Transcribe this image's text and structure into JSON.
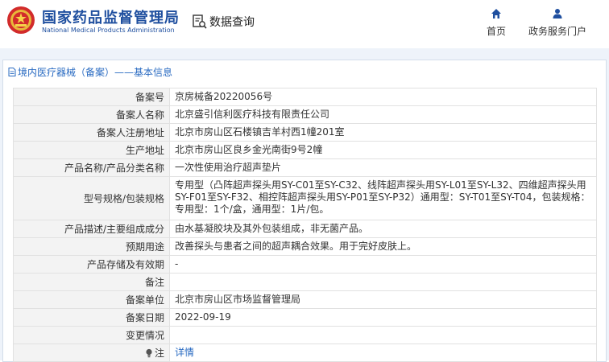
{
  "header": {
    "brand_cn": "国家药品监督管理局",
    "brand_en": "National Medical Products Administration",
    "query_label": "数据查询",
    "nav": [
      {
        "label": "首页",
        "icon": "home-icon"
      },
      {
        "label": "政务服务门户",
        "icon": "user-icon"
      }
    ]
  },
  "panel": {
    "title": "境内医疗器械（备案）——基本信息"
  },
  "rows": [
    {
      "label": "备案号",
      "value": "京房械备20220056号"
    },
    {
      "label": "备案人名称",
      "value": "北京盛引信利医疗科技有限责任公司"
    },
    {
      "label": "备案人注册地址",
      "value": "北京市房山区石楼镇吉羊村西1幢201室"
    },
    {
      "label": "生产地址",
      "value": "北京市房山区良乡金光南街9号2幢"
    },
    {
      "label": "产品名称/产品分类名称",
      "value": "一次性使用治疗超声垫片"
    },
    {
      "label": "型号规格/包装规格",
      "value": "专用型（凸阵超声探头用SY-C01至SY-C32、线阵超声探头用SY-L01至SY-L32、四维超声探头用SY-F01至SY-F32、相控阵超声探头用SY-P01至SY-P32）通用型：SY-T01至SY-T04，包装规格：专用型：1个/盒，通用型：1片/包。"
    },
    {
      "label": "产品描述/主要组成成分",
      "value": "由水基凝胶块及其外包装组成，非无菌产品。"
    },
    {
      "label": "预期用途",
      "value": "改善探头与患者之间的超声耦合效果。用于完好皮肤上。"
    },
    {
      "label": "产品存储及有效期",
      "value": "-"
    },
    {
      "label": "备注",
      "value": ""
    },
    {
      "label": "备案单位",
      "value": "北京市房山区市场监督管理局"
    },
    {
      "label": "备案日期",
      "value": "2022-09-19"
    },
    {
      "label": "变更情况",
      "value": ""
    },
    {
      "label": "注",
      "value": "详情"
    }
  ],
  "colors": {
    "brand_blue": "#1f4f9f",
    "link_blue": "#2a6bc2",
    "band_bg": "#eef3fa",
    "label_bg": "#f3f3f3"
  }
}
